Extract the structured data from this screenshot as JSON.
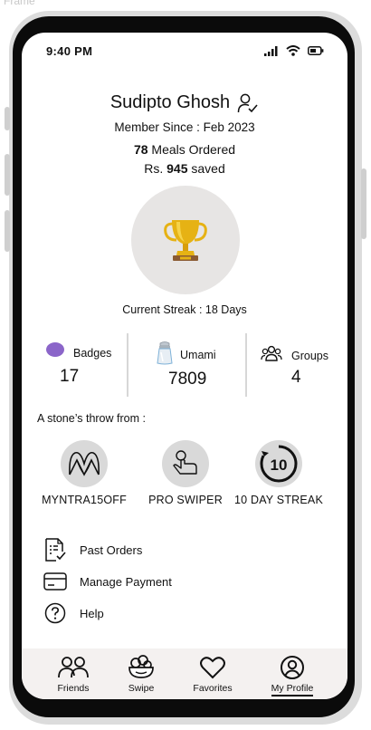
{
  "frame": {
    "label": "Frame"
  },
  "status_bar": {
    "time": "9:40 PM"
  },
  "profile": {
    "name": "Sudipto Ghosh",
    "member_since": "Member Since : Feb 2023",
    "meals_count": "78",
    "meals_label": " Meals Ordered",
    "saved_prefix": "Rs. ",
    "saved_amount": "945",
    "saved_suffix": " saved",
    "streak": "Current Streak : 18 Days"
  },
  "stats": [
    {
      "label": "Badges",
      "value": "17",
      "icon": "purple-ellipse-icon"
    },
    {
      "label": "Umami",
      "value": "7809",
      "icon": "salt-shaker-icon"
    },
    {
      "label": "Groups",
      "value": "4",
      "icon": "people-group-icon"
    }
  ],
  "next_badges": {
    "title": "A stone’s throw from :",
    "items": [
      {
        "label": "MYNTRA15OFF",
        "icon": "myntra-logo-icon"
      },
      {
        "label": "PRO SWIPER",
        "icon": "swipe-hand-icon"
      },
      {
        "label": "10 DAY STREAK",
        "icon": "ten-day-streak-icon",
        "badge_text": "10"
      }
    ]
  },
  "menu": [
    {
      "label": "Past Orders",
      "icon": "receipt-icon"
    },
    {
      "label": "Manage Payment",
      "icon": "credit-card-icon"
    },
    {
      "label": "Help",
      "icon": "question-icon"
    }
  ],
  "tabs": [
    {
      "label": "Friends",
      "icon": "friends-icon"
    },
    {
      "label": "Swipe",
      "icon": "food-bowl-icon"
    },
    {
      "label": "Favorites",
      "icon": "heart-icon"
    },
    {
      "label": "My Profile",
      "icon": "profile-icon",
      "active": true
    }
  ],
  "colors": {
    "badge_purple": "#8b65c9",
    "trophy_gold": "#e6b214",
    "circle_bg": "#e7e5e4",
    "tabbar_bg": "#f4f1f0"
  }
}
